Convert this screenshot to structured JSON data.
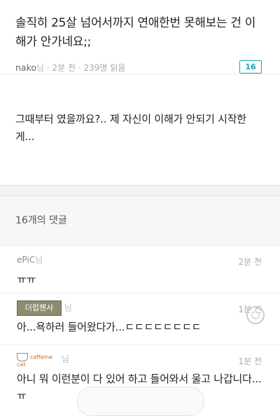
{
  "post": {
    "title": "솔직히 25살 넘어서까지 연애한번 못해보는 건 이해가 안가네요;;",
    "author": "nako",
    "author_suffix": "님",
    "meta": " · 2분 전 · 239명 읽음",
    "comment_badge": "16",
    "body": "그때부터 였을까요?.. 제 자신이 이해가 안되기 시작한게..."
  },
  "comments_section": {
    "header": "16개의 댓글",
    "comments": [
      {
        "name": "ePiC",
        "suffix": "님",
        "time": "2분 전",
        "text": "ㅠㅠ"
      },
      {
        "name": "더럽쳰사",
        "suffix": "님",
        "time": "1분 전",
        "text": "아...욕하러 들어왔다가...ㄷㄷㄷㄷㄷㄷㄷㄷ"
      },
      {
        "name": "caffeine cat",
        "suffix": "님",
        "time": "1분 전",
        "text": "아니 뭐 이런분이 다 있어 하고 들어와서 울고 나갑니다...ㅠ"
      }
    ]
  }
}
